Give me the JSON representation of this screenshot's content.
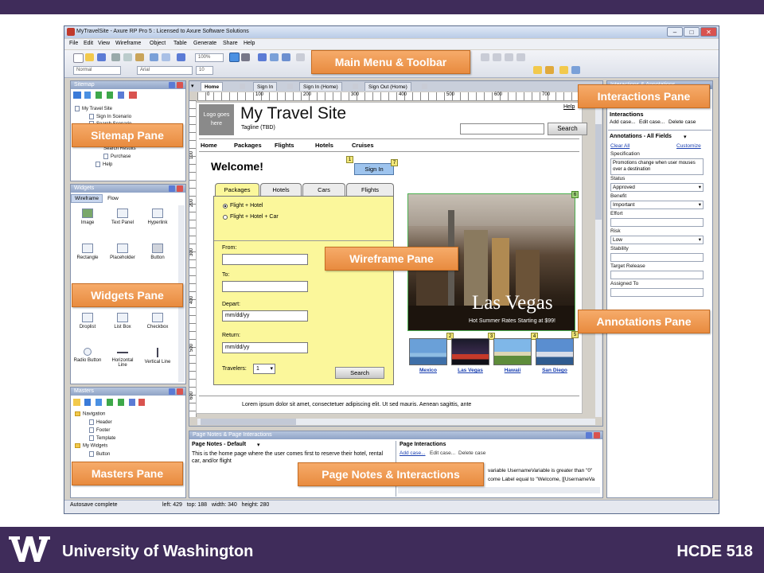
{
  "window": {
    "title": "MyTravelSite - Axure RP Pro 5 : Licensed to Axure Software Solutions"
  },
  "menu": [
    "File",
    "Edit",
    "View",
    "Wireframe",
    "Object",
    "Table",
    "Generate",
    "Share",
    "Help"
  ],
  "toolbar": {
    "zoom": "100%",
    "style": "Normal",
    "font": "Arial",
    "font_size": "10"
  },
  "callouts": {
    "main_menu": "Main Menu & Toolbar",
    "interactions": "Interactions Pane",
    "sitemap": "Sitemap Pane",
    "widgets": "Widgets Pane",
    "wireframe": "Wireframe Pane",
    "annotations": "Annotations Pane",
    "masters": "Masters Pane",
    "page_notes": "Page Notes & Interactions"
  },
  "sitemap": {
    "header": "Sitemap",
    "items": [
      "My Travel Site",
      "Sign In Scenario",
      "Search Scenario",
      "Search Results",
      "Purchase",
      "Help"
    ]
  },
  "widgets": {
    "header": "Widgets",
    "tabs": [
      "Wireframe",
      "Flow"
    ],
    "items": [
      "Image",
      "Text Panel",
      "Hyperlink",
      "Rectangle",
      "Placeholder",
      "Button",
      "Droplist",
      "List Box",
      "Checkbox",
      "Radio Button",
      "Horizontal Line",
      "Vertical Line"
    ]
  },
  "masters": {
    "header": "Masters",
    "items": [
      "Navigation",
      "Header",
      "Footer",
      "Template",
      "My Widgets",
      "Button"
    ]
  },
  "page_tabs": [
    "Home",
    "Sign In",
    "Sign In (Home)",
    "Sign Out (Home)"
  ],
  "ruler": {
    "h": [
      "0",
      "100",
      "200",
      "300",
      "400",
      "500",
      "600",
      "700"
    ],
    "v": [
      "100",
      "200",
      "300",
      "400",
      "500",
      "600"
    ]
  },
  "wireframe": {
    "logo": "Logo goes here",
    "title": "My Travel Site",
    "tagline": "Tagline (TBD)",
    "help": "Help",
    "search_button": "Search",
    "nav": [
      "Home",
      "Packages",
      "Flights",
      "Hotels",
      "Cruises"
    ],
    "welcome": "Welcome!",
    "sign_in": "Sign In",
    "markers": [
      "1",
      "2",
      "3",
      "4",
      "5",
      "6",
      "7"
    ],
    "form_tabs": [
      "Packages",
      "Hotels",
      "Cars",
      "Flights"
    ],
    "radio1": "Flight + Hotel",
    "radio2": "Flight + Hotel + Car",
    "from": "From:",
    "to": "To:",
    "depart": "Depart:",
    "depart_value": "mm/dd/yy",
    "return": "Return:",
    "return_value": "mm/dd/yy",
    "travelers": "Travelers:",
    "travelers_value": "1",
    "form_search": "Search",
    "photo_title": "Las Vegas",
    "photo_subtitle": "Hot Summer Rates Starting at $99!",
    "thumbs": [
      "Mexico",
      "Las Vegas",
      "Hawaii",
      "San Diego"
    ],
    "lorem": "Lorem ipsum dolor sit amet, consectetuer adipiscing elit. Ut sed mauris. Aenean sagittis, ante"
  },
  "page_notes": {
    "header": "Page Notes & Page Interactions",
    "notes_title": "Page Notes - Default",
    "notes_text": "This is the home page where the user comes first to reserve their hotel, rental car, and/or flight",
    "interactions_title": "Page Interactions",
    "add_case": "Add case...",
    "edit_case": "Edit case...",
    "delete_case": "Delete case",
    "case_line1": "variable UsernameVariable is greater than \"0\"",
    "case_line2": "come Label equal to \"Welcome, [[UsernameVa"
  },
  "interactions": {
    "header": "Interactions & Annotations",
    "title": "Interactions",
    "add_case": "Add case...",
    "edit_case": "Edit case...",
    "delete_case": "Delete case"
  },
  "annotations": {
    "title": "Annotations - All Fields",
    "clear_all": "Clear All",
    "customize": "Customize",
    "specification_label": "Specification",
    "specification_value": "Promotions change when user mouses over a destination",
    "status_label": "Status",
    "status_value": "Approved",
    "benefit_label": "Benefit",
    "benefit_value": "Important",
    "effort_label": "Effort",
    "risk_label": "Risk",
    "risk_value": "Low",
    "stability_label": "Stability",
    "target_release_label": "Target Release",
    "assigned_to_label": "Assigned To"
  },
  "statusbar": {
    "left": "Autosave complete",
    "coords": "left: 429   top: 188   width: 340   height: 280"
  },
  "footer": {
    "university": "University of Washington",
    "course": "HCDE 518"
  },
  "colors": {
    "brand_purple": "#3f2c5a",
    "callout_orange": "#e88b3f",
    "form_yellow": "#fbf79b"
  }
}
